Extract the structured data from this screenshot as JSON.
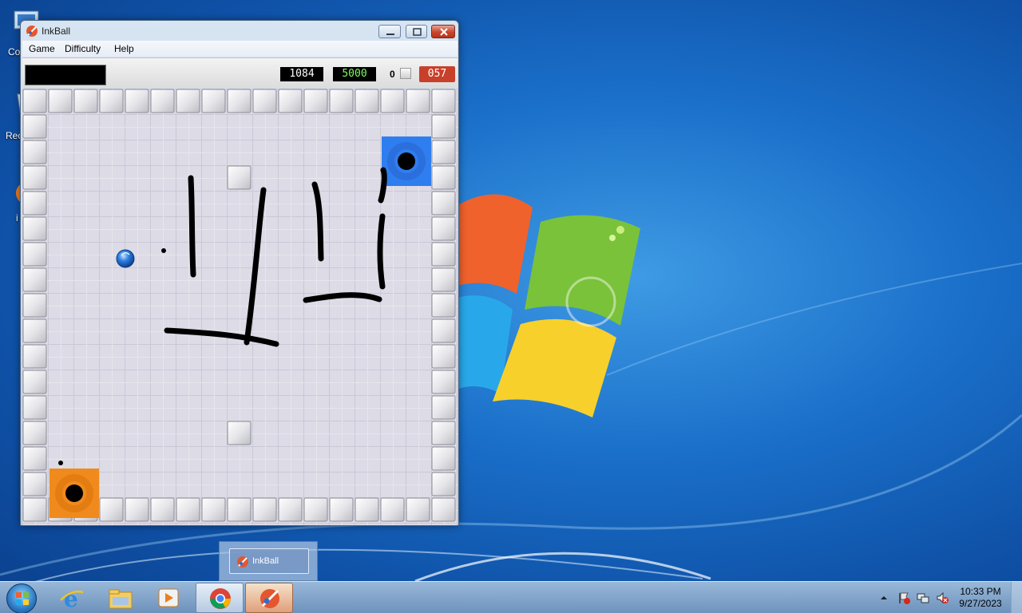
{
  "desktop": {
    "icons": [
      {
        "name": "computer-icon",
        "label": "Co"
      },
      {
        "name": "recycle-bin-icon",
        "label": "Rec"
      },
      {
        "name": "firefox-icon",
        "label": "i"
      }
    ]
  },
  "window": {
    "title": "InkBall",
    "menu": [
      "Game",
      "Difficulty",
      "Help"
    ],
    "status": {
      "score": "1084",
      "target": "5000",
      "caught": "0",
      "timer": "057"
    }
  },
  "board": {
    "ball_color": "#2f7fe0",
    "blue_hole_color": "#2f7ef0",
    "orange_hole_color": "#f08a1c",
    "ink_color": "#000000"
  },
  "preview": {
    "label": "InkBall"
  },
  "taskbar": {
    "apps": [
      "start-button",
      "internet-explorer-icon",
      "file-explorer-icon",
      "media-player-icon",
      "chrome-icon",
      "inkball-icon"
    ],
    "clock_time": "10:33 PM",
    "clock_date": "9/27/2023"
  },
  "colors": {
    "timer": "#c8402a",
    "target_text": "#7cff5a"
  }
}
